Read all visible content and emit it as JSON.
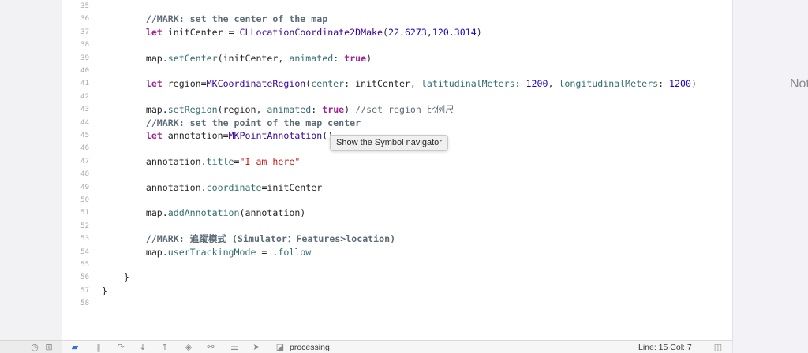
{
  "lines": [
    {
      "n": "35",
      "segs": []
    },
    {
      "n": "36",
      "segs": [
        {
          "t": "        "
        },
        {
          "t": "//MARK: set the center of the map",
          "c": "cmb"
        }
      ]
    },
    {
      "n": "37",
      "segs": [
        {
          "t": "        "
        },
        {
          "t": "let",
          "c": "kw"
        },
        {
          "t": " initCenter = "
        },
        {
          "t": "CLLocationCoordinate2DMake",
          "c": "ty"
        },
        {
          "t": "("
        },
        {
          "t": "22.6273",
          "c": "num"
        },
        {
          "t": ","
        },
        {
          "t": "120.3014",
          "c": "num"
        },
        {
          "t": ")"
        }
      ]
    },
    {
      "n": "38",
      "segs": []
    },
    {
      "n": "39",
      "segs": [
        {
          "t": "        map."
        },
        {
          "t": "setCenter",
          "c": "fn"
        },
        {
          "t": "(initCenter, "
        },
        {
          "t": "animated",
          "c": "fn"
        },
        {
          "t": ": "
        },
        {
          "t": "true",
          "c": "kw"
        },
        {
          "t": ")"
        }
      ]
    },
    {
      "n": "40",
      "segs": []
    },
    {
      "n": "41",
      "segs": [
        {
          "t": "        "
        },
        {
          "t": "let",
          "c": "kw"
        },
        {
          "t": " region="
        },
        {
          "t": "MKCoordinateRegion",
          "c": "ty"
        },
        {
          "t": "("
        },
        {
          "t": "center",
          "c": "fn"
        },
        {
          "t": ": initCenter, "
        },
        {
          "t": "latitudinalMeters",
          "c": "fn"
        },
        {
          "t": ": "
        },
        {
          "t": "1200",
          "c": "num"
        },
        {
          "t": ", "
        },
        {
          "t": "longitudinalMeters",
          "c": "fn"
        },
        {
          "t": ": "
        },
        {
          "t": "1200",
          "c": "num"
        },
        {
          "t": ")"
        }
      ]
    },
    {
      "n": "42",
      "segs": []
    },
    {
      "n": "43",
      "segs": [
        {
          "t": "        map."
        },
        {
          "t": "setRegion",
          "c": "fn"
        },
        {
          "t": "(region, "
        },
        {
          "t": "animated",
          "c": "fn"
        },
        {
          "t": ": "
        },
        {
          "t": "true",
          "c": "kw"
        },
        {
          "t": ") "
        },
        {
          "t": "//set region 比例尺",
          "c": "cm"
        }
      ]
    },
    {
      "n": "44",
      "segs": [
        {
          "t": "        "
        },
        {
          "t": "//MARK: set the point of the map center",
          "c": "cmb"
        }
      ]
    },
    {
      "n": "45",
      "segs": [
        {
          "t": "        "
        },
        {
          "t": "let",
          "c": "kw"
        },
        {
          "t": " annotation="
        },
        {
          "t": "MKPointAnnotation",
          "c": "ty"
        },
        {
          "t": "()"
        }
      ]
    },
    {
      "n": "46",
      "segs": []
    },
    {
      "n": "47",
      "segs": [
        {
          "t": "        annotation."
        },
        {
          "t": "title",
          "c": "fn"
        },
        {
          "t": "="
        },
        {
          "t": "\"I am here\"",
          "c": "str"
        }
      ]
    },
    {
      "n": "48",
      "segs": []
    },
    {
      "n": "49",
      "segs": [
        {
          "t": "        annotation."
        },
        {
          "t": "coordinate",
          "c": "fn"
        },
        {
          "t": "=initCenter"
        }
      ]
    },
    {
      "n": "50",
      "segs": []
    },
    {
      "n": "51",
      "segs": [
        {
          "t": "        map."
        },
        {
          "t": "addAnnotation",
          "c": "fn"
        },
        {
          "t": "(annotation)"
        }
      ]
    },
    {
      "n": "52",
      "segs": []
    },
    {
      "n": "53",
      "segs": [
        {
          "t": "        "
        },
        {
          "t": "//MARK: 追蹤模式 (Simulator：Features>location)",
          "c": "cmb"
        }
      ]
    },
    {
      "n": "54",
      "segs": [
        {
          "t": "        map."
        },
        {
          "t": "userTrackingMode",
          "c": "fn"
        },
        {
          "t": " = ."
        },
        {
          "t": "follow",
          "c": "fn"
        }
      ]
    },
    {
      "n": "55",
      "segs": []
    },
    {
      "n": "56",
      "segs": [
        {
          "t": "    }"
        }
      ]
    },
    {
      "n": "57",
      "segs": [
        {
          "t": "}"
        }
      ]
    },
    {
      "n": "58",
      "segs": []
    }
  ],
  "tooltip": {
    "text": "Show the Symbol navigator"
  },
  "right_panel": {
    "text": "Not"
  },
  "debug_bar": {
    "process": "processing",
    "position": "Line: 15  Col: 7"
  },
  "colors": {
    "keyword": "#9b2393",
    "type": "#3900a0",
    "function": "#326d74",
    "number": "#1c00cf",
    "string": "#c41a16",
    "comment": "#5d6c79"
  }
}
